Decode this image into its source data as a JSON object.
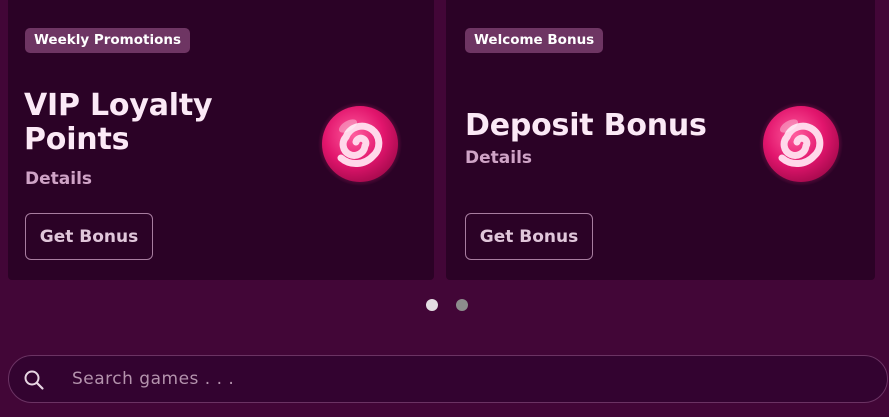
{
  "promotions": [
    {
      "badge": "Weekly Promotions",
      "title": "VIP Loyalty Points",
      "details": "Details",
      "button": "Get Bonus",
      "icon": "swirl-candy-icon"
    },
    {
      "badge": "Welcome Bonus",
      "title": "Deposit Bonus",
      "details": "Details",
      "button": "Get Bonus",
      "icon": "swirl-candy-icon"
    }
  ],
  "carousel": {
    "slide_count": 2,
    "active_index": 0
  },
  "search": {
    "placeholder": "Search games . . .",
    "value": "",
    "icon": "search-icon"
  },
  "colors": {
    "background": "#420637",
    "card": "#2b0226",
    "badge": "#6e3563",
    "candy_pink": "#e2156d",
    "candy_light": "#ffd8ea"
  }
}
